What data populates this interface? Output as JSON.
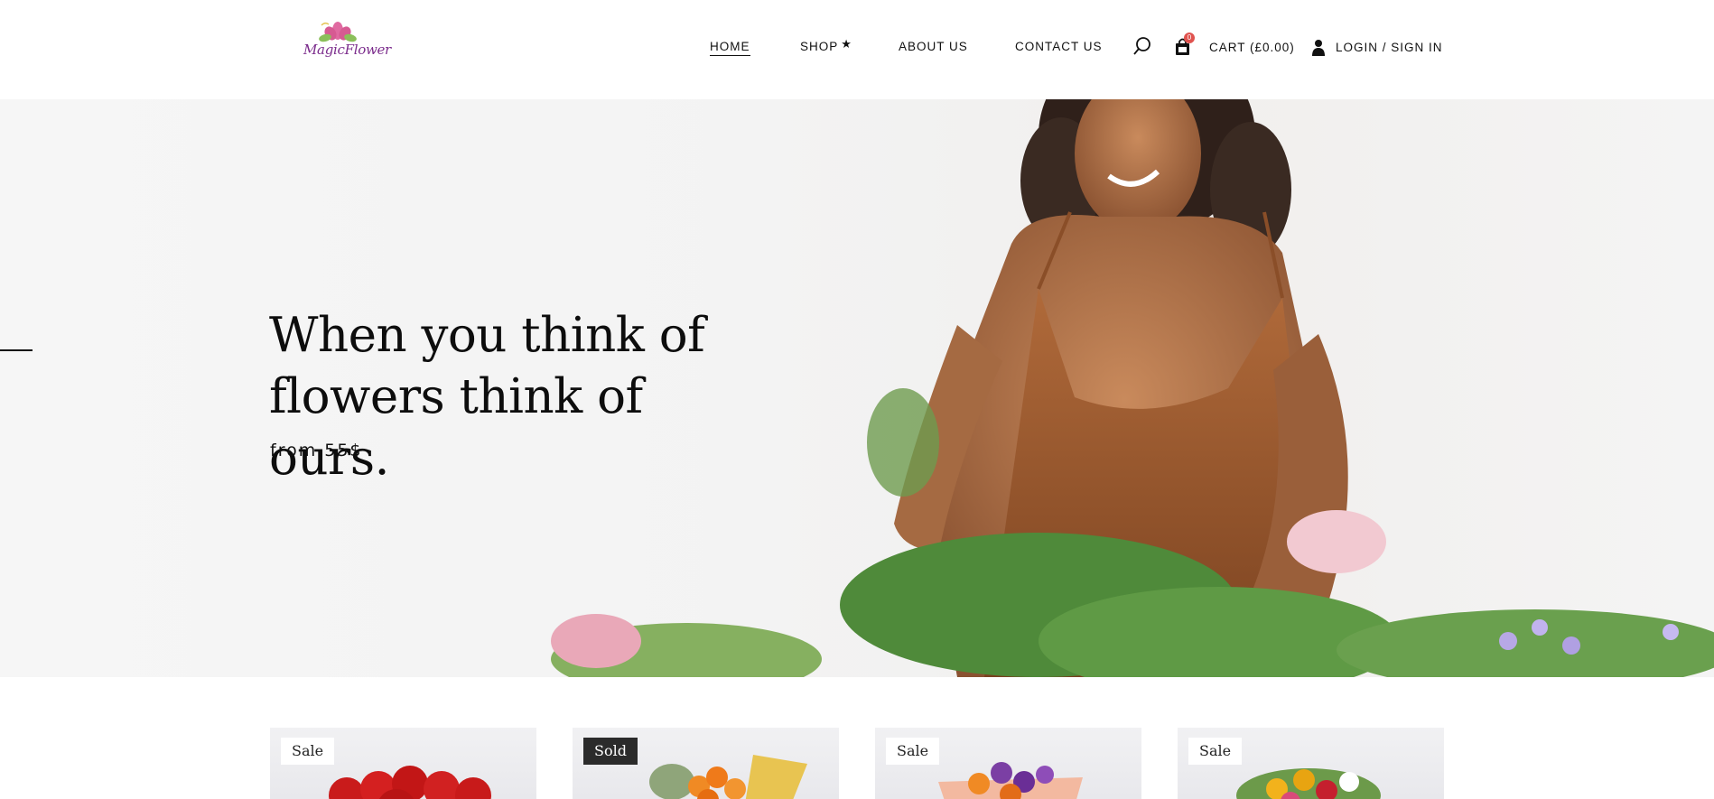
{
  "brand": {
    "logo_text": "MagicFlower"
  },
  "nav": {
    "items": [
      {
        "label": "HOME",
        "active": true
      },
      {
        "label": "SHOP",
        "active": false,
        "marker": "star-icon"
      },
      {
        "label": "ABOUT US",
        "active": false
      },
      {
        "label": "CONTACT US",
        "active": false
      }
    ],
    "search_icon": "search-icon",
    "cart": {
      "icon": "shopping-bag-icon",
      "count": "0",
      "label": "CART (£0.00)"
    },
    "account": {
      "icon": "user-icon",
      "label": "LOGIN / SIGN IN"
    }
  },
  "hero": {
    "title_line1": "When you think of",
    "title_line2": "flowers think of ours.",
    "subtitle": "from 55$"
  },
  "products": [
    {
      "badge": "Sale",
      "badge_style": "light",
      "image": "red-roses-bouquet"
    },
    {
      "badge": "Sold",
      "badge_style": "dark",
      "image": "orange-flower-bouquet"
    },
    {
      "badge": "Sale",
      "badge_style": "light",
      "image": "purple-orange-bouquet"
    },
    {
      "badge": "Sale",
      "badge_style": "light",
      "image": "mixed-sunflower-bouquet"
    }
  ],
  "colors": {
    "accent": "#e0534f",
    "text": "#111111",
    "sold_badge": "#2b2b2b",
    "logo": "#7b2c8c"
  }
}
